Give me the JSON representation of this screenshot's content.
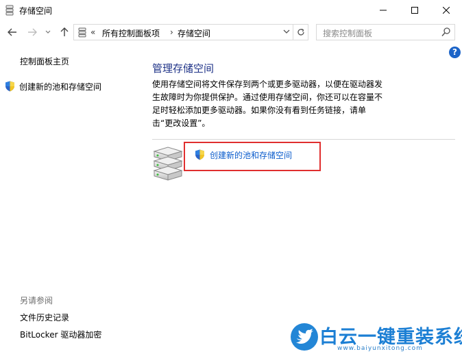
{
  "window": {
    "title": "存储空间"
  },
  "navigation": {
    "breadcrumb_overflow": "«",
    "breadcrumb": [
      "所有控制面板项",
      "存储空间"
    ],
    "breadcrumb_separator": "›",
    "search_placeholder": "搜索控制面板"
  },
  "left_pane": {
    "home_link": "控制面板主页",
    "task_link": "创建新的池和存储空间",
    "see_also_heading": "另请参阅",
    "see_also_links": [
      "文件历史记录",
      "BitLocker 驱动器加密"
    ]
  },
  "main": {
    "title": "管理存储空间",
    "description": "使用存储空间将文件保存到两个或更多驱动器，以便在驱动器发生故障时为你提供保护。通过使用存储空间，你还可以在容量不足时轻松添加更多驱动器。如果你没有看到任务链接，请单击“更改设置”。",
    "create_link": "创建新的池和存储空间"
  },
  "help_label": "?",
  "watermark": {
    "title": "白云一键重装系统",
    "url": "www.baiyunxitong.com"
  },
  "colors": {
    "link_blue": "#0b5ccc",
    "title_blue": "#1e3287",
    "highlight_red": "#e02e2e"
  }
}
